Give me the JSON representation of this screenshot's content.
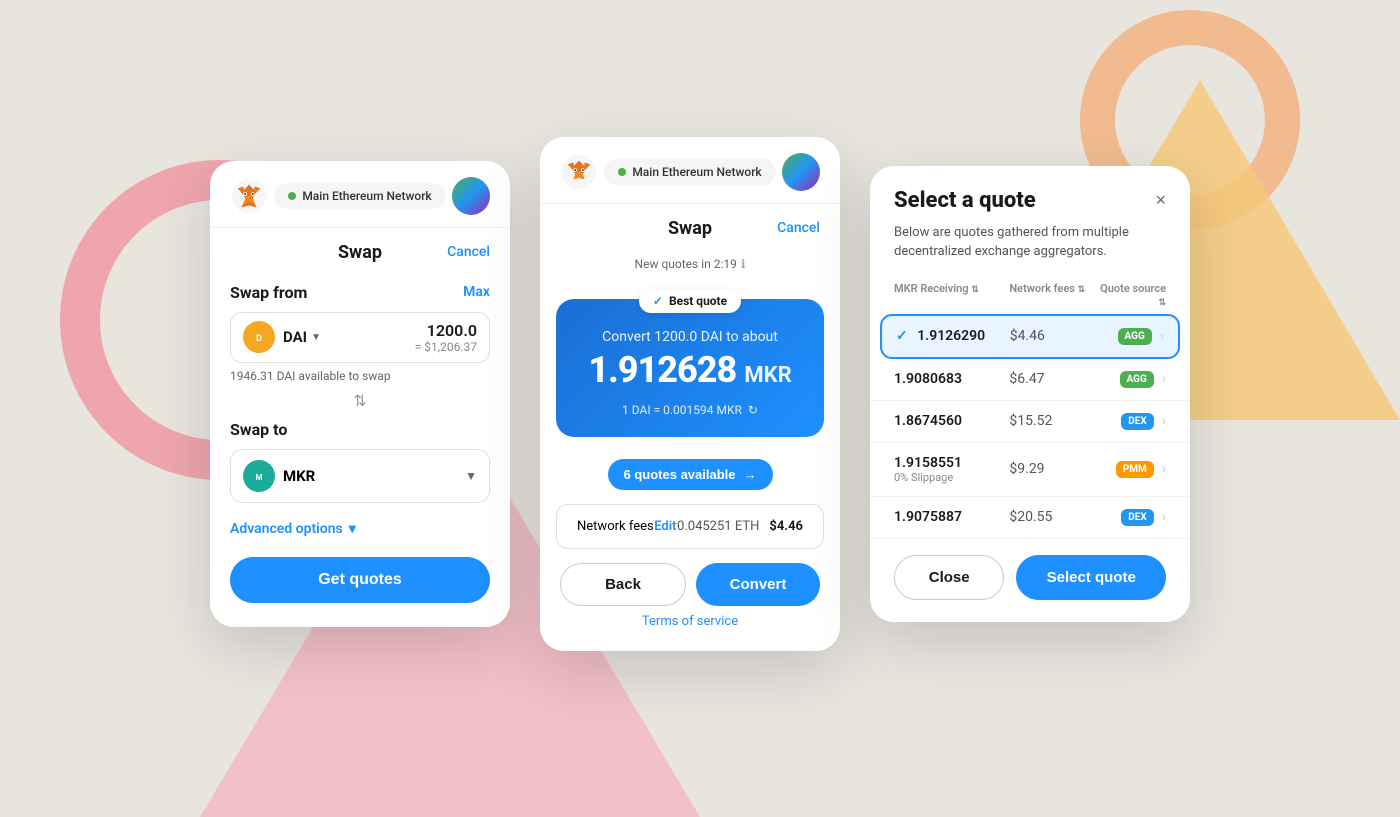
{
  "background": {
    "color": "#e8e4de"
  },
  "card1": {
    "network_label": "Main Ethereum Network",
    "title": "Swap",
    "cancel_label": "Cancel",
    "swap_from_label": "Swap from",
    "max_label": "Max",
    "from_token": "DAI",
    "from_amount": "1200.0",
    "from_usd": "= $1,206.37",
    "available_text": "1946.31 DAI available to swap",
    "swap_to_label": "Swap to",
    "to_token": "MKR",
    "advanced_options_label": "Advanced options",
    "get_quotes_label": "Get quotes"
  },
  "card2": {
    "network_label": "Main Ethereum Network",
    "title": "Swap",
    "cancel_label": "Cancel",
    "timer_text": "New quotes in 2:19",
    "best_quote_label": "Best quote",
    "convert_text": "Convert 1200.0 DAI to about",
    "convert_amount": "1.912628",
    "convert_unit": "MKR",
    "rate_text": "1 DAI = 0.001594 MKR",
    "quotes_available": "6 quotes available",
    "network_fees_label": "Network fees",
    "edit_label": "Edit",
    "eth_amount": "0.045251 ETH",
    "fee_usd": "$4.46",
    "back_label": "Back",
    "convert_label": "Convert",
    "terms_label": "Terms of service"
  },
  "card3": {
    "title": "Select a quote",
    "subtitle": "Below are quotes gathered from multiple decentralized exchange aggregators.",
    "close_label": "×",
    "col_receiving": "MKR Receiving",
    "col_fees": "Network fees",
    "col_source": "Quote source",
    "rows": [
      {
        "amount": "1.9126290",
        "slippage": "",
        "fee": "$4.46",
        "source": "AGG",
        "source_type": "agg",
        "selected": true
      },
      {
        "amount": "1.9080683",
        "slippage": "",
        "fee": "$6.47",
        "source": "AGG",
        "source_type": "agg",
        "selected": false
      },
      {
        "amount": "1.8674560",
        "slippage": "",
        "fee": "$15.52",
        "source": "DEX",
        "source_type": "dex",
        "selected": false
      },
      {
        "amount": "1.9158551",
        "slippage": "0% Slippage",
        "fee": "$9.29",
        "source": "PMM",
        "source_type": "pmm",
        "selected": false
      },
      {
        "amount": "1.9075887",
        "slippage": "",
        "fee": "$20.55",
        "source": "DEX",
        "source_type": "dex",
        "selected": false
      }
    ],
    "close_btn_label": "Close",
    "select_quote_label": "Select quote"
  }
}
